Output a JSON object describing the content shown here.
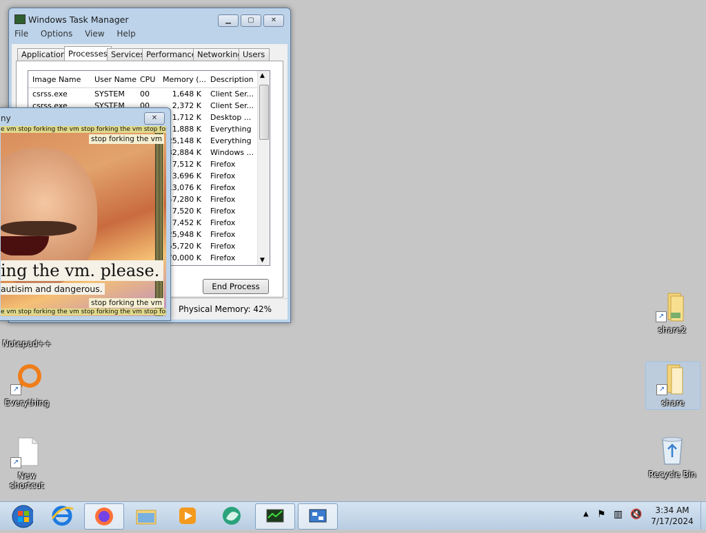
{
  "desktop": {
    "icons": [
      {
        "label": "Notepad++"
      },
      {
        "label": "Everything"
      },
      {
        "label": "New shortcut"
      },
      {
        "label": "share2"
      },
      {
        "label": "share"
      },
      {
        "label": "Recycle Bin"
      }
    ]
  },
  "taskmgr": {
    "title": "Windows Task Manager",
    "menu": [
      "File",
      "Options",
      "View",
      "Help"
    ],
    "tabs": [
      "Applications",
      "Processes",
      "Services",
      "Performance",
      "Networking",
      "Users"
    ],
    "active_tab": "Processes",
    "columns": [
      "Image Name",
      "User Name",
      "CPU",
      "Memory (...",
      "Description"
    ],
    "rows": [
      {
        "name": "csrss.exe",
        "user": "SYSTEM",
        "cpu": "00",
        "mem": "1,648 K",
        "desc": "Client Ser..."
      },
      {
        "name": "csrss.exe",
        "user": "SYSTEM",
        "cpu": "00",
        "mem": "2,372 K",
        "desc": "Client Ser..."
      },
      {
        "mem": "1,712 K",
        "desc": "Desktop ..."
      },
      {
        "mem": "1,888 K",
        "desc": "Everything"
      },
      {
        "mem": "25,148 K",
        "desc": "Everything"
      },
      {
        "mem": "32,884 K",
        "desc": "Windows ..."
      },
      {
        "mem": "7,512 K",
        "desc": "Firefox"
      },
      {
        "mem": "3,696 K",
        "desc": "Firefox"
      },
      {
        "mem": "13,076 K",
        "desc": "Firefox"
      },
      {
        "mem": "47,280 K",
        "desc": "Firefox"
      },
      {
        "mem": "7,520 K",
        "desc": "Firefox"
      },
      {
        "mem": "7,452 K",
        "desc": "Firefox"
      },
      {
        "mem": "25,948 K",
        "desc": "Firefox"
      },
      {
        "mem": "55,720 K",
        "desc": "Firefox"
      },
      {
        "mem": "70,000 K",
        "desc": "Firefox"
      }
    ],
    "end_process_label": "End Process",
    "status_memory": "Physical Memory: 42%"
  },
  "popup": {
    "title": "ny",
    "ticker_text": "e vm stop forking the vm stop forking the vm stop forking the vm stop forking",
    "caption_top": "stop forking the vm",
    "big_text": "ing the vm. please.",
    "sub_text": "autisim and dangerous.",
    "caption_bottom": "stop forking the vm"
  },
  "taskbar": {
    "clock_time": "3:34 AM",
    "clock_date": "7/17/2024",
    "buttons": [
      "start-button",
      "ie-icon",
      "firefox-icon",
      "explorer-icon",
      "media-player-icon",
      "app-icon",
      "taskmgr-icon",
      "network-icon"
    ]
  }
}
